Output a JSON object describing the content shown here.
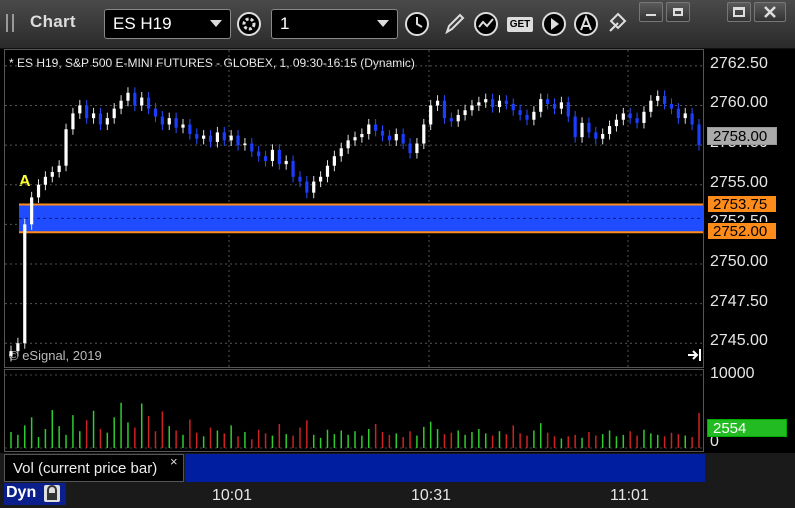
{
  "app": {
    "title": "Chart"
  },
  "toolbar": {
    "symbol": "ES H19",
    "interval": "1",
    "icons": [
      "settings-gear-icon",
      "clock-icon",
      "pencil-icon",
      "study-icon",
      "get-icon",
      "play-icon",
      "alert-icon",
      "move-icon"
    ],
    "get_label": "GET"
  },
  "chart": {
    "header": "* ES H19, S&P 500 E-MINI FUTURES - GLOBEX, 1, 09:30-16:15 (Dynamic)",
    "copyright": "© eSignal, 2019",
    "marker": "A",
    "price_labels": [
      "2762.50",
      "2760.00",
      "2757.50",
      "2755.00",
      "2752.50",
      "2750.00",
      "2747.50",
      "2745.00"
    ],
    "last_price_tag": "2758.00",
    "zone_upper_tag": "2753.75",
    "zone_lower_tag": "2752.00",
    "volume_labels": [
      "10000",
      "0"
    ],
    "volume_tag": "2554",
    "volume_legend": "Vol (current price bar)",
    "close_glyph": "×",
    "time_labels": [
      "10:01",
      "10:31",
      "11:01"
    ],
    "dyn_label": "Dyn",
    "colors": {
      "zone": "#1f4cff",
      "zone_border": "#ff8c1a",
      "up_bar": "#ffffff",
      "down_bar": "#1a3dff",
      "vol_up": "#2ecc2e",
      "vol_down": "#cc2222",
      "tag_volume": "#22bb22"
    }
  },
  "chart_data": {
    "type": "candlestick",
    "ylim": [
      2743.5,
      2763.5
    ],
    "closes": [
      2744.5,
      2745,
      2752.5,
      2754.2,
      2755,
      2755.5,
      2755.8,
      2756.2,
      2758.5,
      2759.5,
      2760,
      2759.2,
      2759.5,
      2758.8,
      2759.2,
      2759.8,
      2760.3,
      2760.8,
      2760,
      2760.5,
      2759.8,
      2759.3,
      2758.8,
      2759.2,
      2758.6,
      2758.8,
      2758.2,
      2757.9,
      2758.1,
      2757.7,
      2758.3,
      2757.8,
      2758.1,
      2757.5,
      2757.6,
      2757.1,
      2756.8,
      2756.5,
      2757.2,
      2756.3,
      2756.5,
      2755.5,
      2755.2,
      2754.5,
      2755.2,
      2755.5,
      2756.2,
      2756.8,
      2757.3,
      2757.8,
      2758,
      2758.2,
      2758.8,
      2758.4,
      2758.1,
      2757.8,
      2758.2,
      2757.6,
      2757,
      2757.6,
      2758.8,
      2760,
      2760.3,
      2759.2,
      2759,
      2759.4,
      2759.7,
      2760,
      2760.2,
      2760.4,
      2759.9,
      2760.3,
      2760.1,
      2759.7,
      2759.4,
      2759.1,
      2759.6,
      2760.4,
      2760.1,
      2759.8,
      2760.2,
      2759.3,
      2758,
      2758.9,
      2758.3,
      2757.9,
      2758.2,
      2758.7,
      2759.1,
      2759.5,
      2759.2,
      2758.9,
      2759.6,
      2760.3,
      2760.6,
      2760.1,
      2759.8,
      2759.2,
      2759.5,
      2758.8,
      2757.5
    ],
    "volumes": [
      2200,
      1800,
      3100,
      4200,
      1500,
      2600,
      5200,
      3000,
      1800,
      4500,
      2300,
      3800,
      5100,
      2600,
      2100,
      4200,
      6200,
      3500,
      2800,
      6100,
      4400,
      2300,
      5000,
      3000,
      2400,
      1800,
      3900,
      2100,
      1600,
      2800,
      2400,
      2000,
      3100,
      1600,
      2200,
      1200,
      2500,
      2000,
      1700,
      3300,
      1900,
      1700,
      2800,
      3800,
      1800,
      1400,
      2500,
      1900,
      2400,
      1800,
      2300,
      1700,
      2600,
      3300,
      2200,
      1800,
      2000,
      1500,
      2300,
      1700,
      2900,
      3600,
      2600,
      1900,
      2100,
      2400,
      1800,
      2200,
      2600,
      2000,
      1700,
      2300,
      1900,
      3100,
      2000,
      1700,
      2400,
      3400,
      2100,
      1600,
      1300,
      1600,
      1800,
      1400,
      2200,
      1700,
      1900,
      2400,
      1600,
      1800,
      2300,
      1700,
      2500,
      2000,
      1800,
      1600,
      2100,
      1900,
      1700,
      1500,
      4800
    ],
    "volume_ylim": [
      0,
      10000
    ],
    "zone": [
      2752.0,
      2753.75
    ]
  }
}
